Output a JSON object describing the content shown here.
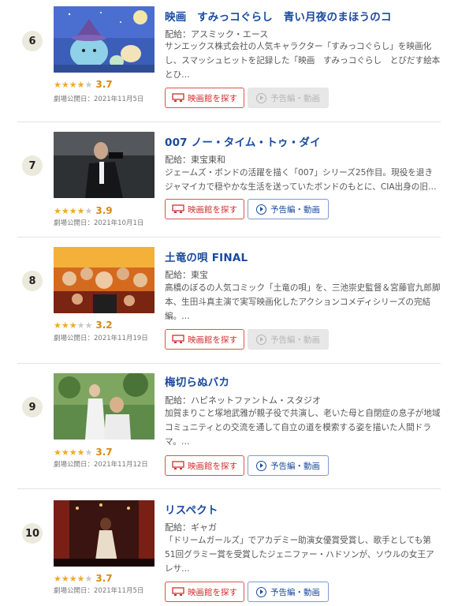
{
  "movies": [
    {
      "rank": "6",
      "title": "映画　すみっコぐらし　青い月夜のまほうのコ",
      "distributor": "配給：アスミック・エース",
      "description": "サンエックス株式会社の人気キャラクター「すみっコぐらし」を映画化し、スマッシュヒットを記録した「映画　すみっコぐらし　とびだす絵本とひ…",
      "rating": 3.7,
      "rating_label": "3.7",
      "release": "劇場公開日：2021年11月5日",
      "theater_label": "映画館を探す",
      "trailer_label": "予告編・動画",
      "trailer_available": false
    },
    {
      "rank": "7",
      "title": "007 ノー・タイム・トゥ・ダイ",
      "distributor": "配給：東宝東和",
      "description": "ジェームズ・ボンドの活躍を描く「007」シリーズ25作目。現役を退きジャマイカで穏やかな生活を送っていたボンドのもとに、CIA出身の旧…",
      "rating": 3.9,
      "rating_label": "3.9",
      "release": "劇場公開日：2021年10月1日",
      "theater_label": "映画館を探す",
      "trailer_label": "予告編・動画",
      "trailer_available": true
    },
    {
      "rank": "8",
      "title": "土竜の唄 FINAL",
      "distributor": "配給：東宝",
      "description": "高橋のぼるの人気コミック「土竜の唄」を、三池崇史監督＆宮藤官九郎脚本、生田斗真主演で実写映画化したアクションコメディシリーズの完結編。…",
      "rating": 3.2,
      "rating_label": "3.2",
      "release": "劇場公開日：2021年11月19日",
      "theater_label": "映画館を探す",
      "trailer_label": "予告編・動画",
      "trailer_available": false
    },
    {
      "rank": "9",
      "title": "梅切らぬバカ",
      "distributor": "配給：ハピネットファントム・スタジオ",
      "description": "加賀まりこと塚地武雅が親子役で共演し、老いた母と自閉症の息子が地域コミュニティとの交流を通して自立の道を模索する姿を描いた人間ドラマ。…",
      "rating": 3.7,
      "rating_label": "3.7",
      "release": "劇場公開日：2021年11月12日",
      "theater_label": "映画館を探す",
      "trailer_label": "予告編・動画",
      "trailer_available": true
    },
    {
      "rank": "10",
      "title": "リスペクト",
      "distributor": "配給：ギャガ",
      "description": "「ドリームガールズ」でアカデミー助演女優賞受賞し、歌手としても第51回グラミー賞を受賞したジェニファー・ハドソンが、ソウルの女王アレサ…",
      "rating": 3.7,
      "rating_label": "3.7",
      "release": "劇場公開日：2021年11月5日",
      "theater_label": "映画館を探す",
      "trailer_label": "予告編・動画",
      "trailer_available": true
    }
  ],
  "colors": {
    "title": "#1a4a9e",
    "star": "#f0a92d",
    "score": "#d88a12",
    "theater_button": "#d12e2e",
    "trailer_button": "#1a4a9e"
  }
}
